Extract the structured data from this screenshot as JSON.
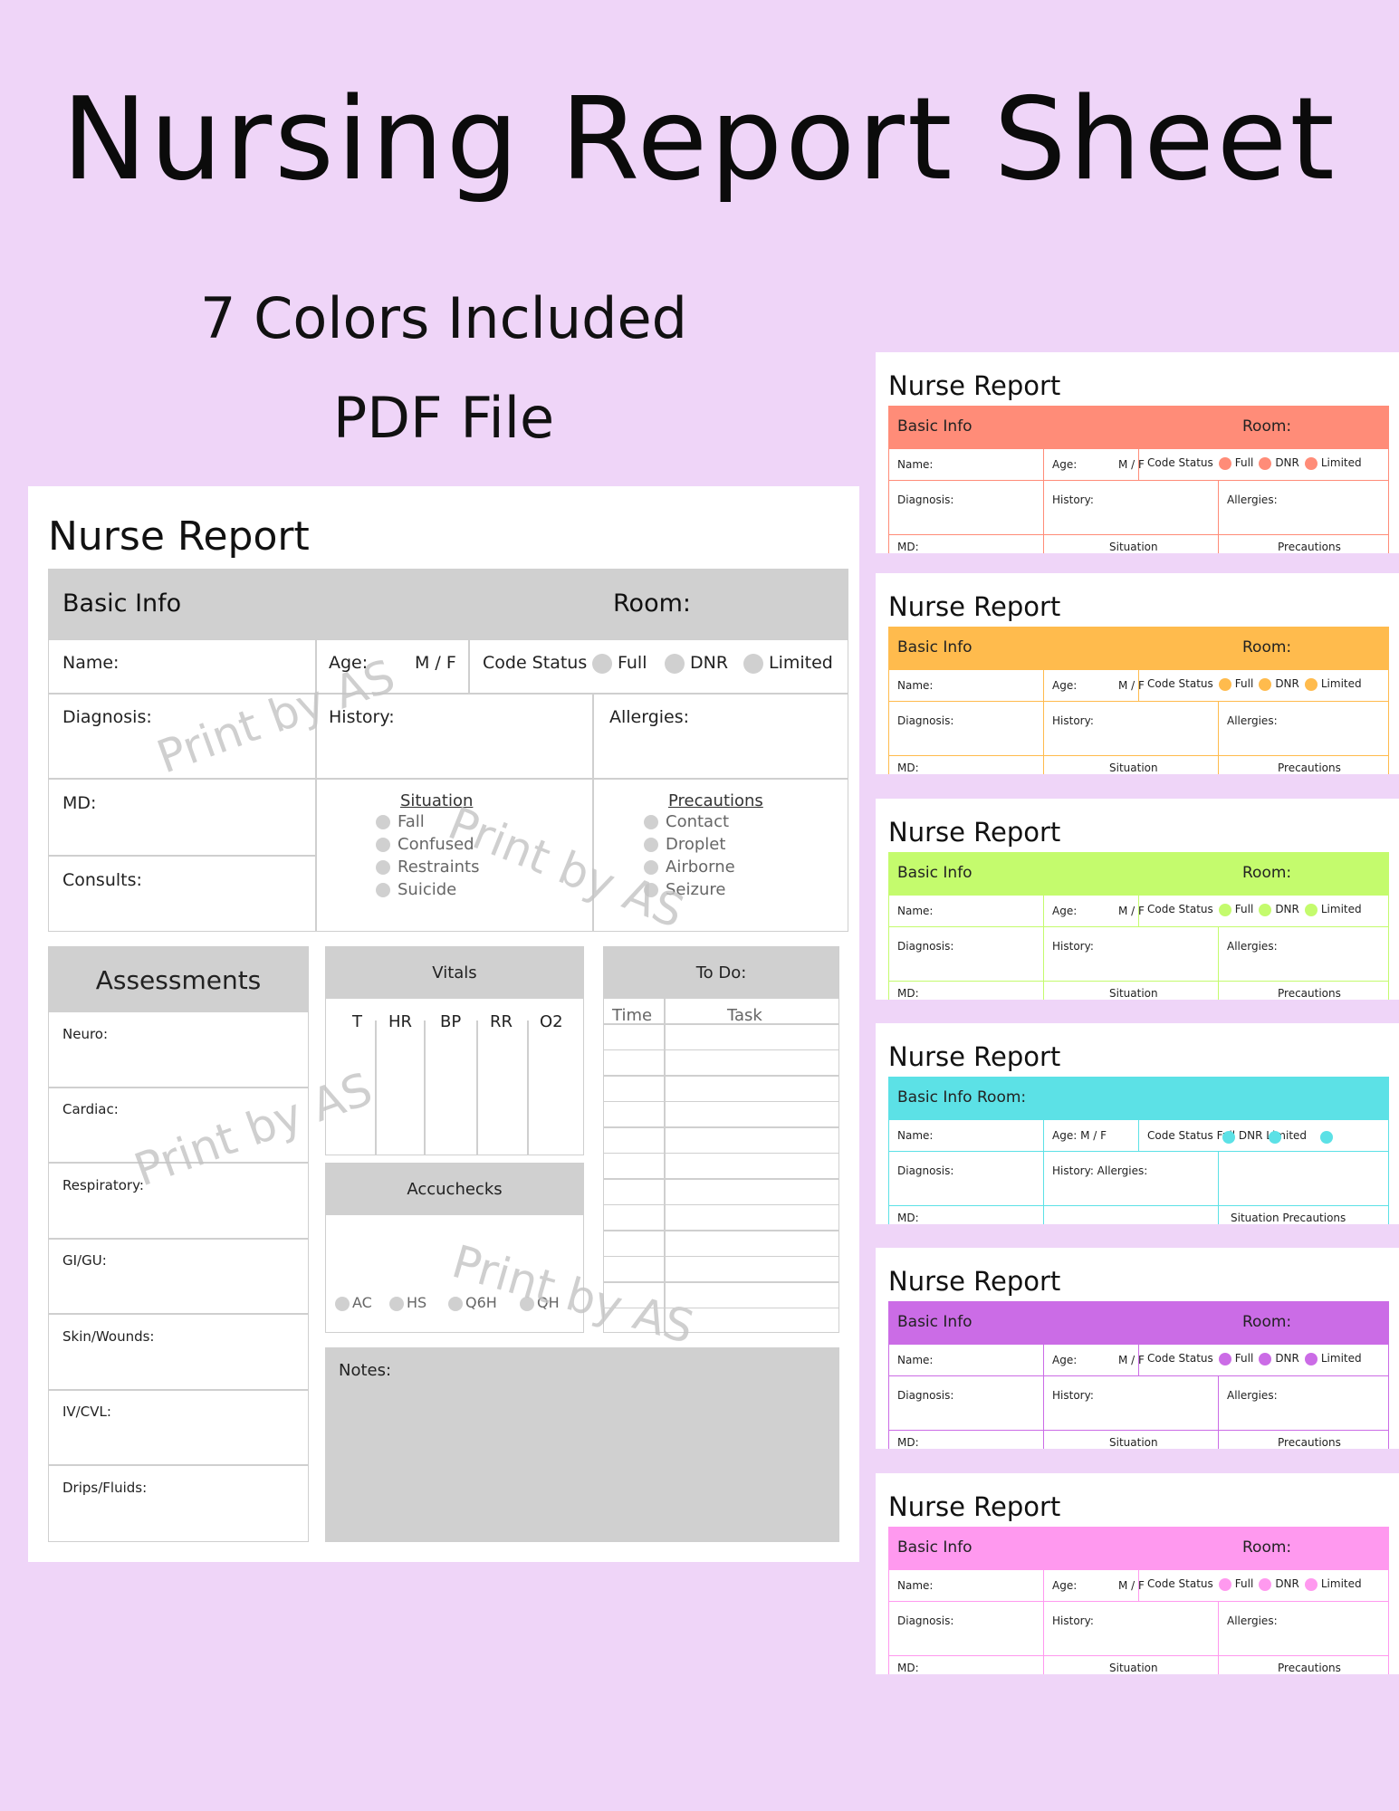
{
  "header": {
    "title": "Nursing Report Sheet",
    "subtitle": "7 Colors Included",
    "file_type": "PDF File"
  },
  "sheet": {
    "title": "Nurse Report",
    "basic_info": "Basic Info",
    "room": "Room:",
    "name": "Name:",
    "age": "Age:",
    "sex": "M / F",
    "code_status": "Code Status",
    "code_options": [
      "Full",
      "DNR",
      "Limited"
    ],
    "diagnosis": "Diagnosis:",
    "history": "History:",
    "allergies": "Allergies:",
    "md": "MD:",
    "consults": "Consults:",
    "situation": {
      "heading": "Situation",
      "items": [
        "Fall",
        "Confused",
        "Restraints",
        "Suicide"
      ]
    },
    "precautions": {
      "heading": "Precautions",
      "items": [
        "Contact",
        "Droplet",
        "Airborne",
        "Seizure"
      ]
    },
    "assessments": {
      "heading": "Assessments",
      "items": [
        "Neuro:",
        "Cardiac:",
        "Respiratory:",
        "GI/GU:",
        "Skin/Wounds:",
        "IV/CVL:",
        "Drips/Fluids:"
      ]
    },
    "vitals": {
      "heading": "Vitals",
      "columns": [
        "T",
        "HR",
        "BP",
        "RR",
        "O2"
      ]
    },
    "accuchecks": {
      "heading": "Accuchecks",
      "options": [
        "AC",
        "HS",
        "Q6H",
        "QH"
      ]
    },
    "todo": {
      "heading": "To Do:",
      "time": "Time",
      "task": "Task"
    },
    "notes": "Notes:",
    "watermark": "Print by AS"
  },
  "mini_sheets": {
    "title": "Nurse Report",
    "basic_info": "Basic Info",
    "room": "Room:",
    "basic_info_room": "Basic Info Room:",
    "name": "Name:",
    "age": "Age:",
    "sex": "M / F",
    "age_sex": "Age: M / F",
    "code_status": "Code Status",
    "code_status_inline": "Code Status Full DNR Limited",
    "full": "Full",
    "dnr": "DNR",
    "limited": "Limited",
    "diagnosis": "Diagnosis:",
    "history": "History:",
    "allergies": "Allergies:",
    "history_allergies": "History: Allergies:",
    "md": "MD:",
    "situation": "Situation",
    "precautions": "Precautions",
    "situation_precautions": "Situation Precautions",
    "colors": [
      "#ff8c78",
      "#ffbb4d",
      "#c4fb6d",
      "#5ce1e6",
      "#cb6ce6",
      "#ff99ef"
    ]
  }
}
